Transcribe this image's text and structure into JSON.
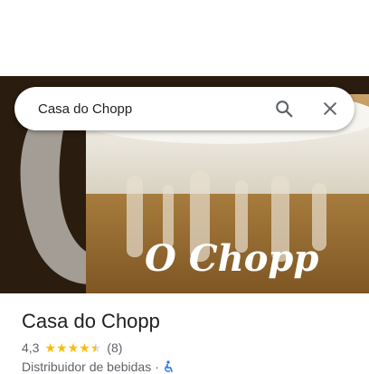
{
  "search": {
    "query": "Casa do Chopp"
  },
  "hero": {
    "image_text": "O Chopp"
  },
  "place": {
    "name": "Casa do Chopp",
    "rating": "4,3",
    "rating_value": 4.3,
    "review_count": "(8)",
    "category": "Distribuidor de bebidas",
    "separator": "·"
  },
  "icons": {
    "search": "search-icon",
    "close": "close-icon",
    "star": "star-icon",
    "accessibility": "wheelchair-icon"
  },
  "colors": {
    "star": "#fbbc04",
    "accessibility": "#1a73e8",
    "text_primary": "#202124",
    "text_secondary": "#5f6368"
  }
}
